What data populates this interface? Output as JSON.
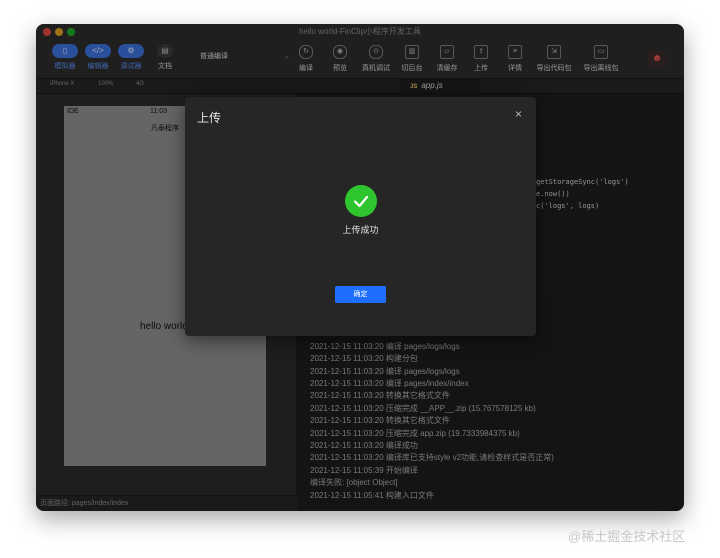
{
  "window": {
    "title": "hello world-FinClip小程序开发工具"
  },
  "toolbar": {
    "left_buttons": [
      {
        "label": "模拟器",
        "icon": "phone-icon"
      },
      {
        "label": "编辑器",
        "icon": "code-icon"
      },
      {
        "label": "调试器",
        "icon": "debug-icon"
      },
      {
        "label": "文档",
        "icon": "doc-icon"
      }
    ],
    "compile_mode": "普通编译",
    "right_buttons": [
      {
        "label": "编译",
        "icon": "refresh-icon"
      },
      {
        "label": "预览",
        "icon": "eye-icon"
      },
      {
        "label": "真机调试",
        "icon": "device-icon"
      },
      {
        "label": "切后台",
        "icon": "background-icon"
      },
      {
        "label": "清缓存",
        "icon": "clear-cache-icon"
      },
      {
        "label": "上传",
        "icon": "upload-icon"
      },
      {
        "label": "详情",
        "icon": "detail-icon"
      },
      {
        "label": "导出代码包",
        "icon": "export-icon"
      },
      {
        "label": "导出离线包",
        "icon": "folder-icon"
      }
    ]
  },
  "simulator": {
    "device": "iPhone X",
    "zoom": "100%",
    "network": "4G",
    "status_left": "IDE",
    "status_time": "11:03",
    "nav_title": "凡泰程序",
    "page_text": "hello world",
    "page_path": "页面路径: pages/index/index"
  },
  "editor": {
    "tab": "app.js",
    "code_lines": [
      "getStorageSync('logs')",
      "e.now())",
      "c('logs', logs)"
    ]
  },
  "console": {
    "logs": [
      "2021-12-15 11:03:20 编译 pages/logs/logs",
      "2021-12-15 11:03:20 构建分包",
      "2021-12-15 11:03:20 编译 pages/logs/logs",
      "2021-12-15 11:03:20 编译 pages/index/index",
      "2021-12-15 11:03:20 转换其它格式文件",
      "2021-12-15 11:03:20 压缩完成 __APP__.zip (15.767578125 kb)",
      "2021-12-15 11:03:20 转换其它格式文件",
      "2021-12-15 11:03:20 压缩完成 app.zip (19.7333984375 kb)",
      "2021-12-15 11:03:20 编译成功",
      "2021-12-15 11:03:20 编译库已支持style v2功能,请检查样式是否正常)",
      "2021-12-15 11:05:39 开始编译",
      "编译失败: [object Object]",
      "2021-12-15 11:05:41 构建入口文件"
    ]
  },
  "dialog": {
    "title": "上传",
    "close": "×",
    "message": "上传成功",
    "confirm": "确定"
  },
  "watermark": "@稀土掘金技术社区"
}
